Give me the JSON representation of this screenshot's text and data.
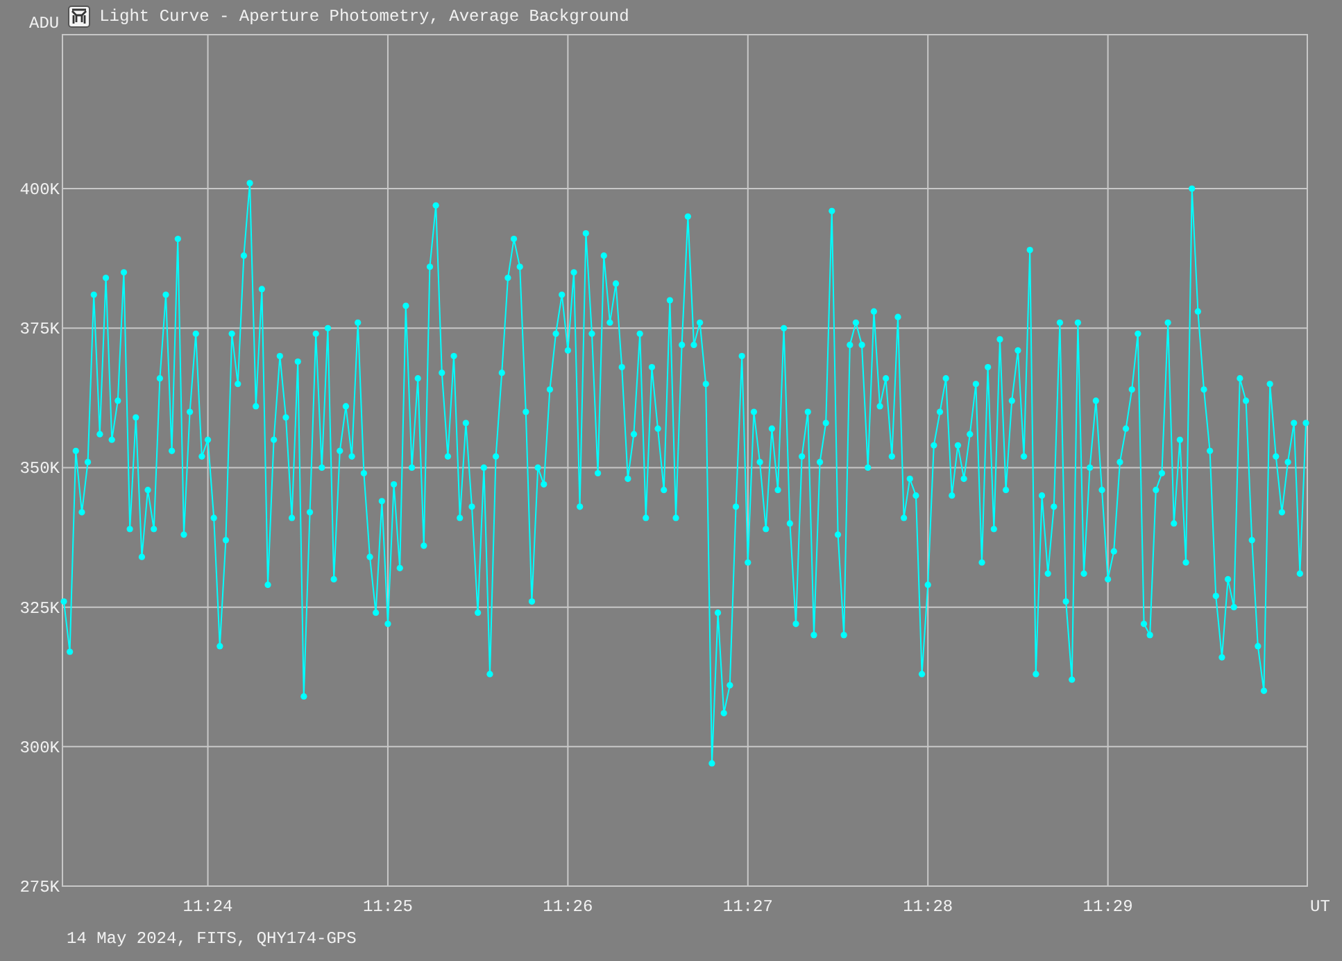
{
  "window": {
    "title": "Light Curve - Aperture Photometry, Average Background"
  },
  "chart": {
    "chart_data": {
      "type": "line",
      "grid": true,
      "ylabel": "ADU",
      "xlabel": "UT",
      "ylim": [
        275,
        427.6
      ],
      "yticks": [
        {
          "value": 275,
          "label": "275K"
        },
        {
          "value": 300,
          "label": "300K"
        },
        {
          "value": 325,
          "label": "325K"
        },
        {
          "value": 350,
          "label": "350K"
        },
        {
          "value": 375,
          "label": "375K"
        },
        {
          "value": 400,
          "label": "400K"
        }
      ],
      "categories": [
        null,
        null,
        null,
        null,
        null,
        null,
        null,
        null,
        null,
        null,
        null,
        null,
        null,
        null,
        null,
        null,
        null,
        null,
        null,
        null,
        null,
        null,
        null,
        null,
        "11:24",
        null,
        null,
        null,
        null,
        null,
        null,
        null,
        null,
        null,
        null,
        null,
        null,
        null,
        null,
        null,
        null,
        null,
        null,
        null,
        null,
        null,
        null,
        null,
        null,
        null,
        null,
        null,
        null,
        null,
        "11:25",
        null,
        null,
        null,
        null,
        null,
        null,
        null,
        null,
        null,
        null,
        null,
        null,
        null,
        null,
        null,
        null,
        null,
        null,
        null,
        null,
        null,
        null,
        null,
        null,
        null,
        null,
        null,
        null,
        null,
        "11:26",
        null,
        null,
        null,
        null,
        null,
        null,
        null,
        null,
        null,
        null,
        null,
        null,
        null,
        null,
        null,
        null,
        null,
        null,
        null,
        null,
        null,
        null,
        null,
        null,
        null,
        null,
        null,
        null,
        null,
        "11:27",
        null,
        null,
        null,
        null,
        null,
        null,
        null,
        null,
        null,
        null,
        null,
        null,
        null,
        null,
        null,
        null,
        null,
        null,
        null,
        null,
        null,
        null,
        null,
        null,
        null,
        null,
        null,
        null,
        null,
        "11:28",
        null,
        null,
        null,
        null,
        null,
        null,
        null,
        null,
        null,
        null,
        null,
        null,
        null,
        null,
        null,
        null,
        null,
        null,
        null,
        null,
        null,
        null,
        null,
        null,
        null,
        null,
        null,
        null,
        null,
        "11:29",
        null,
        null,
        null,
        null,
        null,
        null,
        null,
        null,
        null,
        null,
        null,
        null,
        null,
        null,
        null,
        null,
        null,
        null,
        null,
        null,
        null,
        null,
        null,
        null,
        null,
        null,
        null,
        null,
        null,
        null,
        null,
        null,
        null
      ],
      "series": [
        {
          "marker": "circle",
          "color": "#00ffff",
          "values": [
            326,
            317,
            353,
            342,
            351,
            381,
            356,
            384,
            355,
            362,
            385,
            339,
            359,
            334,
            346,
            339,
            366,
            381,
            353,
            391,
            338,
            360,
            374,
            352,
            355,
            341,
            318,
            337,
            374,
            365,
            388,
            401,
            361,
            382,
            329,
            355,
            370,
            359,
            341,
            369,
            309,
            342,
            374,
            350,
            375,
            330,
            353,
            361,
            352,
            376,
            349,
            334,
            324,
            344,
            322,
            347,
            332,
            379,
            350,
            366,
            336,
            386,
            397,
            367,
            352,
            370,
            341,
            358,
            343,
            324,
            350,
            313,
            352,
            367,
            384,
            391,
            386,
            360,
            326,
            350,
            347,
            364,
            374,
            381,
            371,
            385,
            343,
            392,
            374,
            349,
            388,
            376,
            383,
            368,
            348,
            356,
            374,
            341,
            368,
            357,
            346,
            380,
            341,
            372,
            395,
            372,
            376,
            365,
            297,
            324,
            306,
            311,
            343,
            370,
            333,
            360,
            351,
            339,
            357,
            346,
            375,
            340,
            322,
            352,
            360,
            320,
            351,
            358,
            396,
            338,
            320,
            372,
            376,
            372,
            350,
            378,
            361,
            366,
            352,
            377,
            341,
            348,
            345,
            313,
            329,
            354,
            360,
            366,
            345,
            354,
            348,
            356,
            365,
            333,
            368,
            339,
            373,
            346,
            362,
            371,
            352,
            389,
            313,
            345,
            331,
            343,
            376,
            326,
            312,
            376,
            331,
            350,
            362,
            346,
            330,
            335,
            351,
            357,
            364,
            374,
            322,
            320,
            346,
            349,
            376,
            340,
            355,
            333,
            400,
            378,
            364,
            353,
            327,
            316,
            330,
            325,
            366,
            362,
            337,
            318,
            310,
            365,
            352,
            342,
            351,
            358,
            331,
            358
          ]
        }
      ]
    }
  },
  "footer": "14 May 2024, FITS, QHY174-GPS"
}
